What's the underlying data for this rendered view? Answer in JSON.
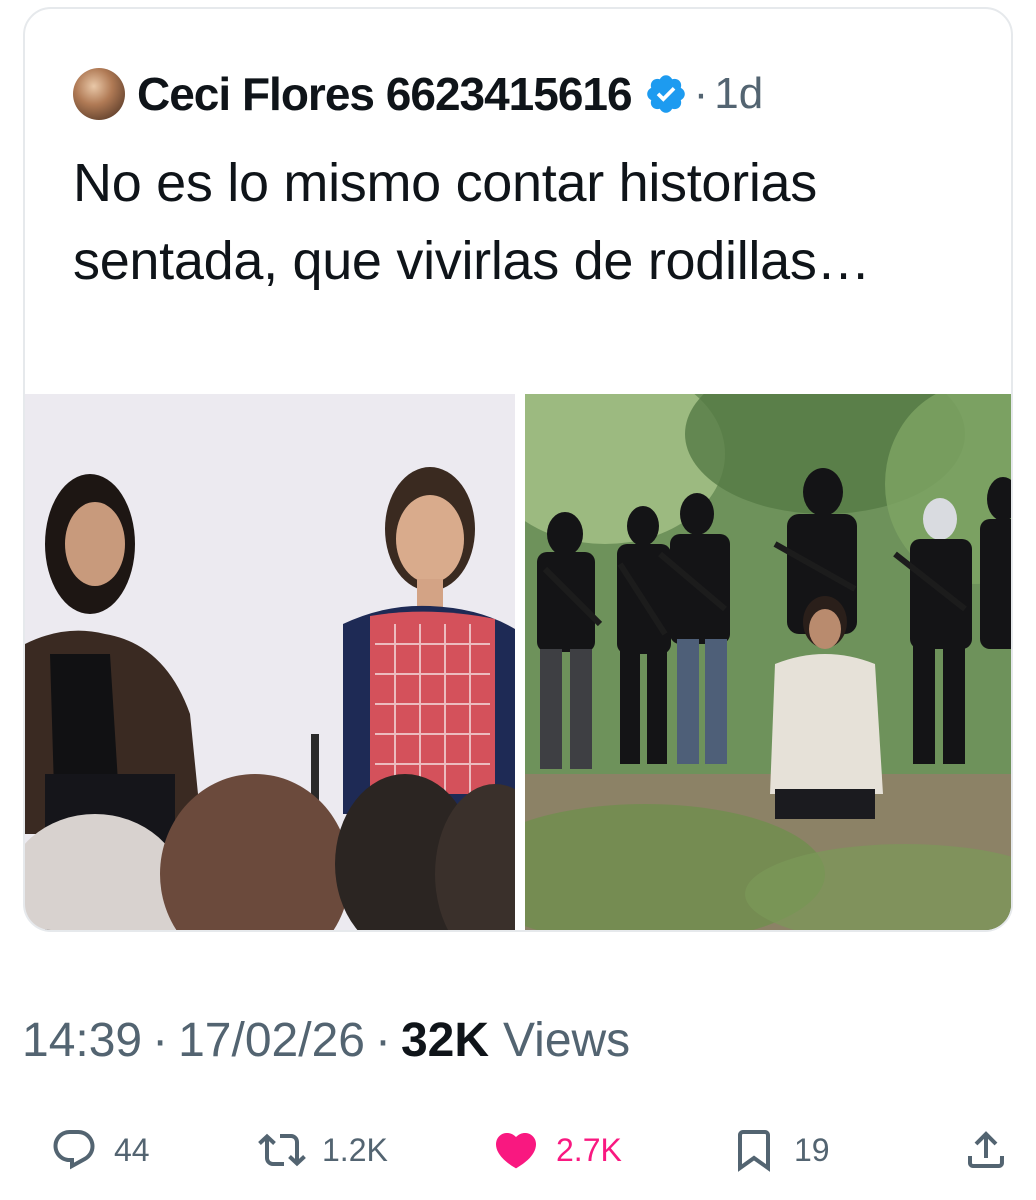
{
  "quote": {
    "author_name": "Ceci Flores 6623415616",
    "dot": "·",
    "time_ago": "1d",
    "text": "No es lo mismo contar historias sentada, que vivirlas de rodillas…"
  },
  "tweet": {
    "time": "14:39",
    "sep": "·",
    "date": "17/02/26",
    "views_count": "32K",
    "views_label": "Views"
  },
  "actions": {
    "replies": "44",
    "reposts": "1.2K",
    "likes": "2.7K",
    "bookmarks": "19"
  },
  "colors": {
    "like_active": "#f91880",
    "muted": "#536471",
    "verified": "#1d9bf0"
  },
  "icons": [
    "verified-icon",
    "reply-icon",
    "repost-icon",
    "like-icon",
    "bookmark-icon",
    "share-icon"
  ]
}
